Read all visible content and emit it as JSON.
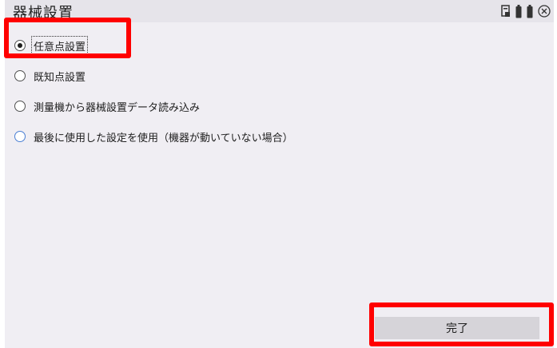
{
  "window": {
    "title": "器械設置"
  },
  "status_icons": [
    "document-icon",
    "battery-icon",
    "battery-icon",
    "close-icon"
  ],
  "options": [
    {
      "label": "任意点設置",
      "selected": true,
      "focused": true
    },
    {
      "label": "既知点設置",
      "selected": false
    },
    {
      "label": "測量機から器械設置データ読み込み",
      "selected": false
    },
    {
      "label": "最後に使用した設定を使用（機器が動いていない場合）",
      "selected": false
    }
  ],
  "footer": {
    "done_label": "完了"
  },
  "colors": {
    "highlight": "#ff0000",
    "background": "#f0eef3",
    "button": "#d6d4d9",
    "radio_blue": "#4a7fd4"
  }
}
